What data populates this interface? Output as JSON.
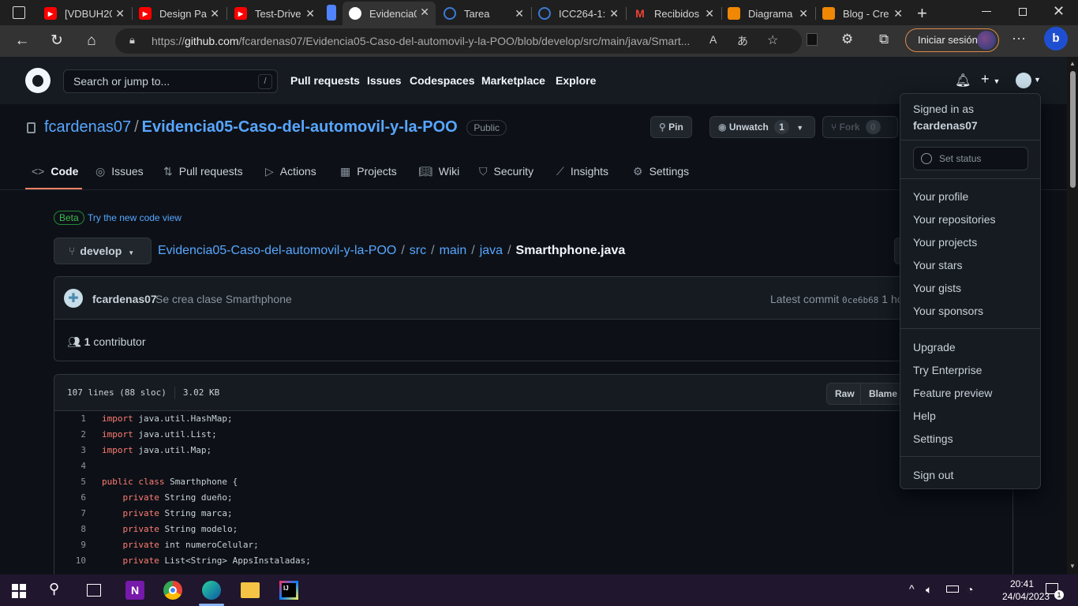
{
  "browser": {
    "tabs": [
      {
        "title": "[VDBUH20",
        "icon": "youtube-icon",
        "color": "#ff0000"
      },
      {
        "title": "Design Pa",
        "icon": "youtube-icon",
        "color": "#ff0000"
      },
      {
        "title": "Test-Drive",
        "icon": "youtube-icon",
        "color": "#ff0000"
      },
      {
        "title": "Evidencia0",
        "icon": "github-icon",
        "color": "#ffffff"
      },
      {
        "title": "Tarea",
        "icon": "moodle-icon",
        "color": "#3a7bd5"
      },
      {
        "title": "ICC264-1:",
        "icon": "moodle-icon",
        "color": "#3a7bd5"
      },
      {
        "title": "Recibidos",
        "icon": "gmail-icon",
        "color": "#ea4335"
      },
      {
        "title": "Diagrama",
        "icon": "drawio-icon",
        "color": "#f08705"
      },
      {
        "title": "Blog - Cre",
        "icon": "drawio-icon",
        "color": "#f08705"
      }
    ],
    "url_prefix": "https://",
    "url_host": "github.com",
    "url_path": "/fcardenas07/Evidencia05-Caso-del-automovil-y-la-POO/blob/develop/src/main/java/Smart...",
    "signin_label": "Iniciar sesión"
  },
  "github": {
    "search_placeholder": "Search or jump to...",
    "search_shortcut": "/",
    "nav": [
      "Pull requests",
      "Issues",
      "Codespaces",
      "Marketplace",
      "Explore"
    ]
  },
  "repo": {
    "owner": "fcardenas07",
    "name": "Evidencia05-Caso-del-automovil-y-la-POO",
    "visibility": "Public",
    "pin_label": "Pin",
    "unwatch_label": "Unwatch",
    "watch_count": "1",
    "fork_label": "Fork",
    "fork_count": "0",
    "tabs": [
      "Code",
      "Issues",
      "Pull requests",
      "Actions",
      "Projects",
      "Wiki",
      "Security",
      "Insights",
      "Settings"
    ]
  },
  "file": {
    "beta_label": "Beta",
    "beta_link": "Try the new code view",
    "branch": "develop",
    "breadcrumb": [
      "Evidencia05-Caso-del-automovil-y-la-POO",
      "src",
      "main",
      "java"
    ],
    "filename": "Smarthphone.java",
    "commit_author": "fcardenas07",
    "commit_message": "Se crea clase Smarthphone",
    "latest_commit_label": "Latest commit",
    "commit_sha": "0ce6b68",
    "commit_time_fragment": "1 ho",
    "contributors_count": "1",
    "contributors_label": "contributor",
    "lines_info": "107 lines (88 sloc)",
    "size_info": "3.02 KB",
    "raw_label": "Raw",
    "blame_label": "Blame",
    "code_lines": [
      {
        "n": "1",
        "kw": "import",
        "rest": " java.util.HashMap;"
      },
      {
        "n": "2",
        "kw": "import",
        "rest": " java.util.List;"
      },
      {
        "n": "3",
        "kw": "import",
        "rest": " java.util.Map;"
      },
      {
        "n": "4",
        "kw": "",
        "rest": ""
      },
      {
        "n": "5",
        "kw": "public class",
        "rest": " Smarthphone {"
      },
      {
        "n": "6",
        "kw": "    private",
        "rest": " String dueño;"
      },
      {
        "n": "7",
        "kw": "    private",
        "rest": " String marca;"
      },
      {
        "n": "8",
        "kw": "    private",
        "rest": " String modelo;"
      },
      {
        "n": "9",
        "kw": "    private",
        "rest": " int numeroCelular;"
      },
      {
        "n": "10",
        "kw": "    private",
        "rest": " List<String> AppsInstaladas;"
      }
    ]
  },
  "dropdown": {
    "signed_in_as": "Signed in as",
    "username": "fcardenas07",
    "set_status": "Set status",
    "group1": [
      "Your profile",
      "Your repositories",
      "Your projects",
      "Your stars",
      "Your gists",
      "Your sponsors"
    ],
    "group2": [
      "Upgrade",
      "Try Enterprise",
      "Feature preview",
      "Help",
      "Settings"
    ],
    "sign_out": "Sign out"
  },
  "taskbar": {
    "time": "20:41",
    "date": "24/04/2023",
    "notification_count": "1"
  }
}
